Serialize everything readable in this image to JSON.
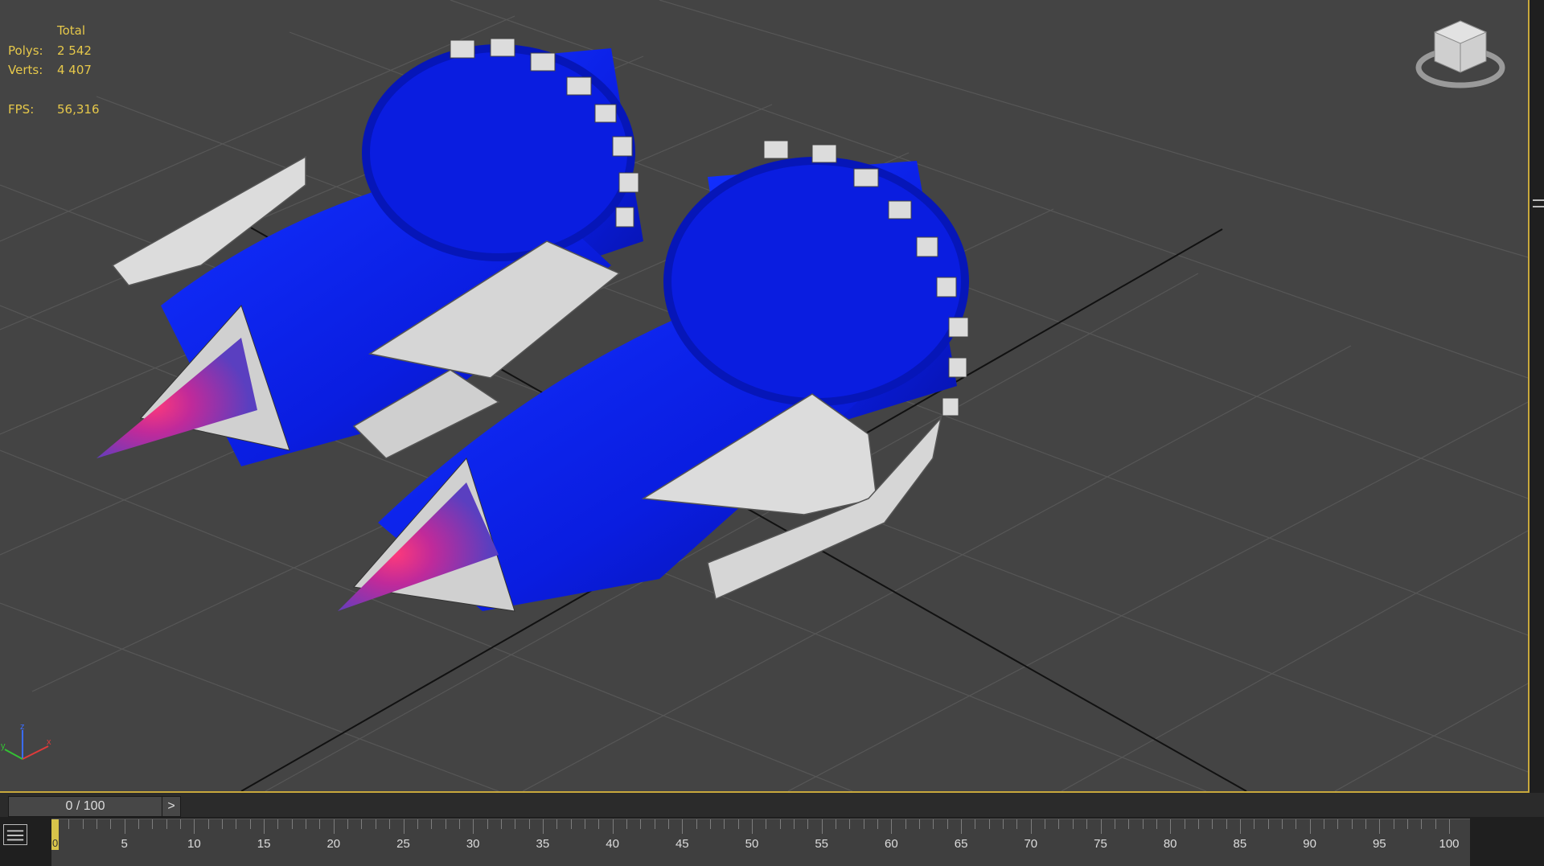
{
  "viewport": {
    "stats": {
      "header": "Total",
      "polys_label": "Polys:",
      "polys_value": "2 542",
      "verts_label": "Verts:",
      "verts_value": "4 407",
      "fps_label": "FPS:",
      "fps_value": "56,316"
    },
    "viewcube": {
      "icon": "viewcube-icon"
    },
    "axis": {
      "icon": "axis-tripod-icon",
      "labels": [
        "x",
        "y",
        "z"
      ]
    }
  },
  "track_bar": {
    "time_slider_label": "0 / 100",
    "next_button": ">",
    "current_frame": "0",
    "tick_labels": [
      "5",
      "10",
      "15",
      "20",
      "25",
      "30",
      "35",
      "40",
      "45",
      "50",
      "55",
      "60",
      "65",
      "70",
      "75",
      "80",
      "85",
      "90",
      "95",
      "100"
    ]
  },
  "colors": {
    "viewport_bg": "#444444",
    "stats_text": "#e6c84a",
    "model_blue": "#0a1be8",
    "panel_grey": "#d9d9d9",
    "active_border": "#c8a83c"
  }
}
